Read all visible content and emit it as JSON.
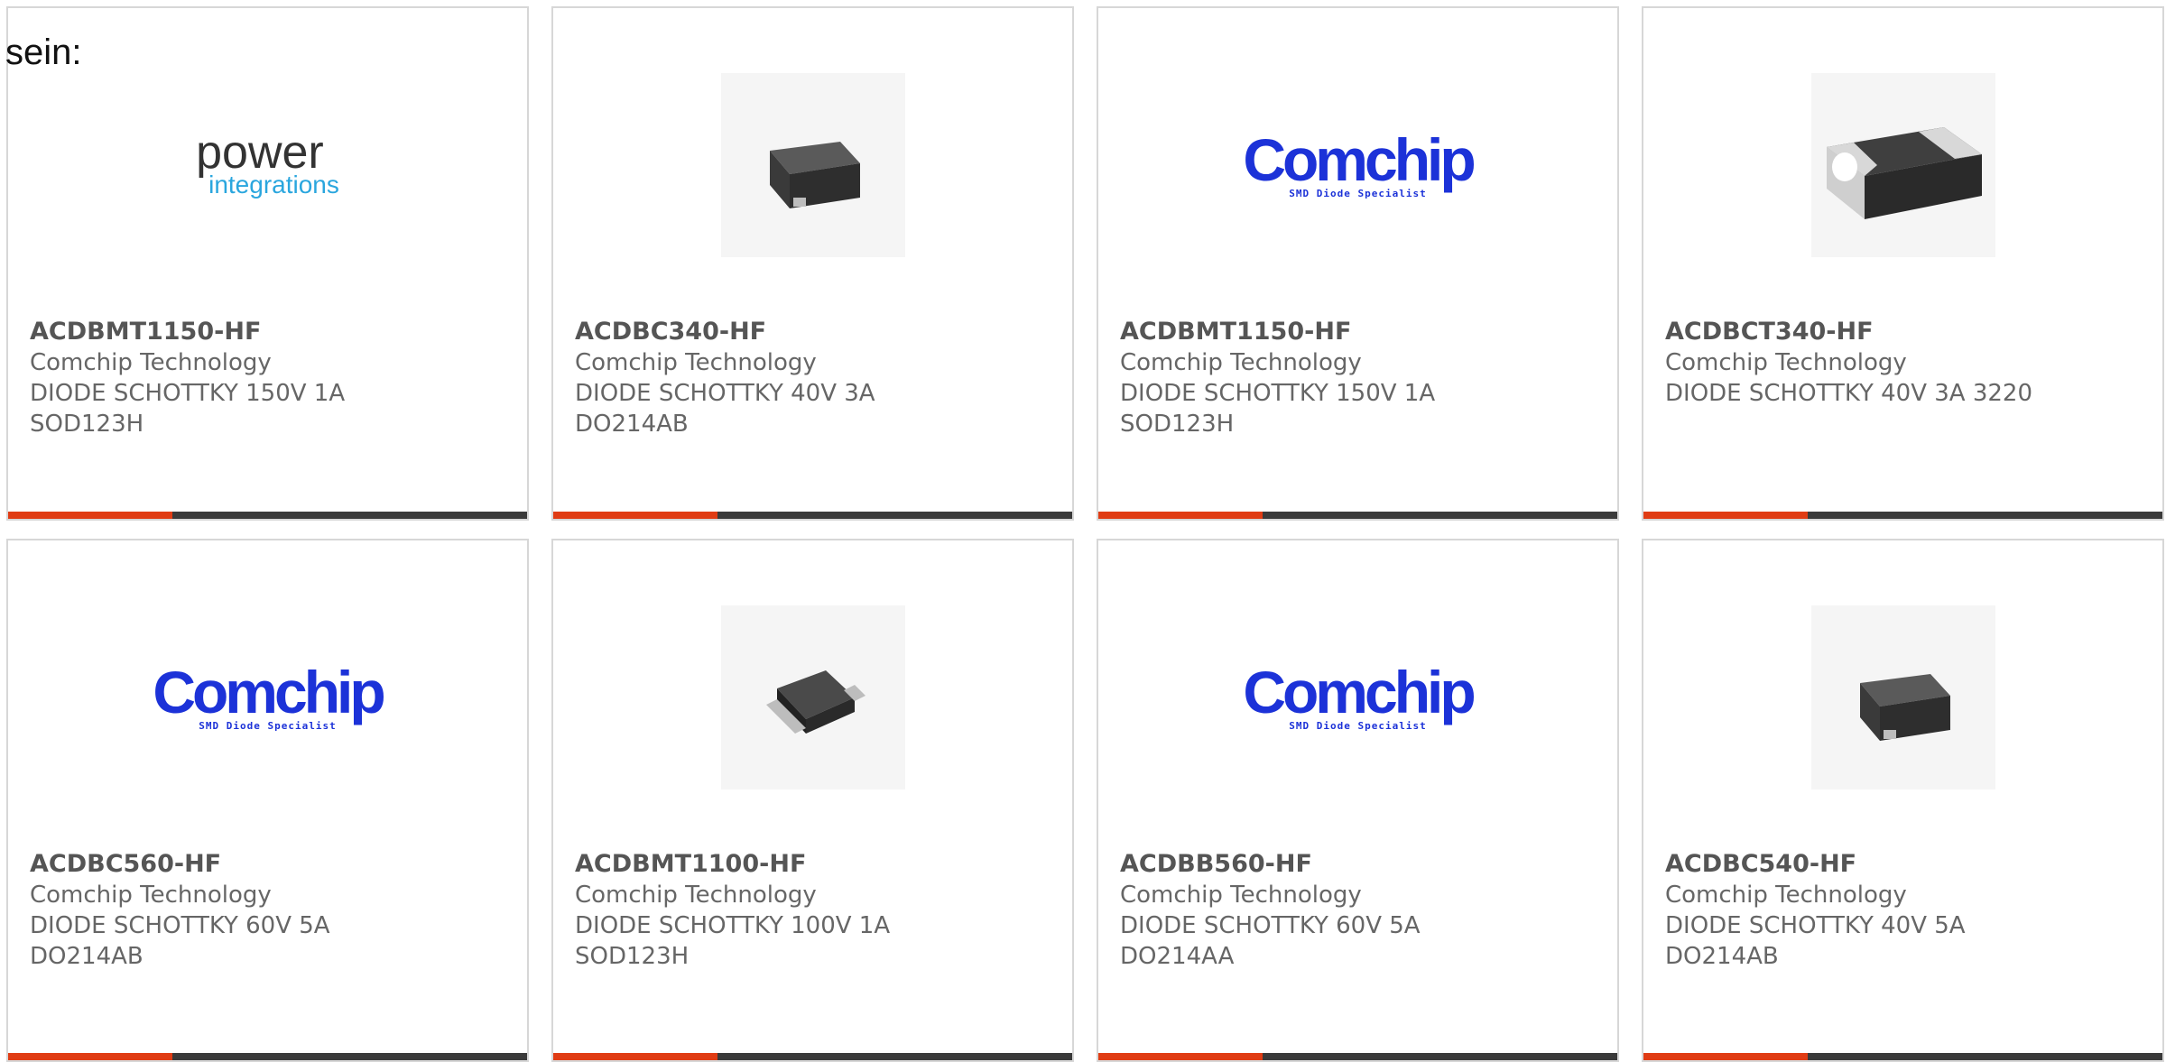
{
  "intro_text": "sein:",
  "colors": {
    "accent": "#e03c14",
    "bar": "#3a3a3a",
    "brand_comchip": "#1c32d8",
    "brand_power": "#2aa6de"
  },
  "products": [
    {
      "part": "ACDBMT1150-HF",
      "maker": "Comchip Technology",
      "desc": "DIODE SCHOTTKY 150V 1A",
      "pkg": "SOD123H",
      "image": "power-integrations-logo",
      "logo_text": "power",
      "logo_sub": "integrations"
    },
    {
      "part": "ACDBC340-HF",
      "maker": "Comchip Technology",
      "desc": "DIODE SCHOTTKY 40V 3A",
      "pkg": "DO214AB",
      "image": "smd-diode-photo"
    },
    {
      "part": "ACDBMT1150-HF",
      "maker": "Comchip Technology",
      "desc": "DIODE SCHOTTKY 150V 1A",
      "pkg": "SOD123H",
      "image": "comchip-logo",
      "logo_text": "Comchip",
      "logo_sub": "SMD Diode Specialist"
    },
    {
      "part": "ACDBCT340-HF",
      "maker": "Comchip Technology",
      "desc": "DIODE SCHOTTKY 40V 3A 3220",
      "pkg": "",
      "image": "smd-chip-photo"
    },
    {
      "part": "ACDBC560-HF",
      "maker": "Comchip Technology",
      "desc": "DIODE SCHOTTKY 60V 5A",
      "pkg": "DO214AB",
      "image": "comchip-logo",
      "logo_text": "Comchip",
      "logo_sub": "SMD Diode Specialist"
    },
    {
      "part": "ACDBMT1100-HF",
      "maker": "Comchip Technology",
      "desc": "DIODE SCHOTTKY 100V 1A",
      "pkg": "SOD123H",
      "image": "sod123-photo"
    },
    {
      "part": "ACDBB560-HF",
      "maker": "Comchip Technology",
      "desc": "DIODE SCHOTTKY 60V 5A",
      "pkg": "DO214AA",
      "image": "comchip-logo",
      "logo_text": "Comchip",
      "logo_sub": "SMD Diode Specialist"
    },
    {
      "part": "ACDBC540-HF",
      "maker": "Comchip Technology",
      "desc": "DIODE SCHOTTKY 40V 5A",
      "pkg": "DO214AB",
      "image": "smd-diode-photo"
    }
  ]
}
